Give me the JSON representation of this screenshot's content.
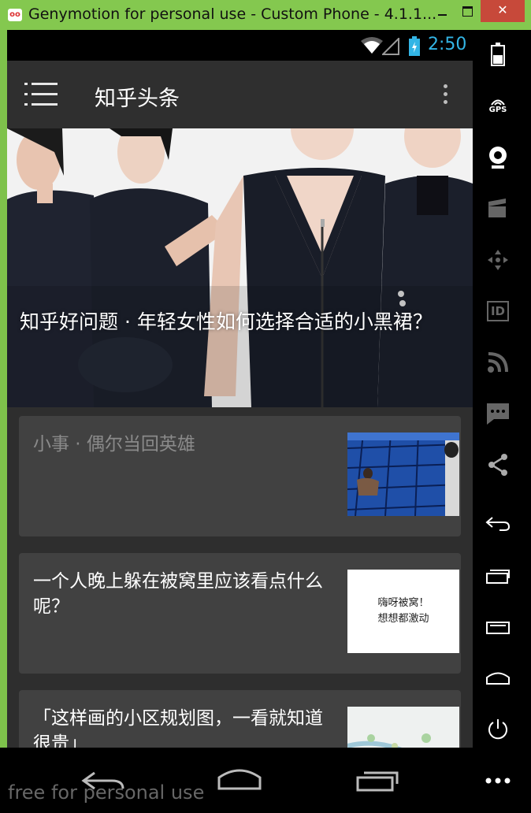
{
  "window": {
    "title": "Genymotion for personal use - Custom Phone - 4.1.1...",
    "close_glyph": "✕"
  },
  "status_bar": {
    "time": "2:50",
    "clock_color": "#33b5e5"
  },
  "action_bar": {
    "title": "知乎头条",
    "menu_icon": "hamburger-icon",
    "overflow_icon": "overflow-menu-icon"
  },
  "hero": {
    "caption": "知乎好问题 · 年轻女性如何选择合适的小黑裙？"
  },
  "stories": [
    {
      "title": "小事 · 偶尔当回英雄",
      "read": true,
      "thumbnail": "swimming-pool-photo"
    },
    {
      "title": "一个人晚上躲在被窝里应该看点什么呢？",
      "read": false,
      "thumbnail_text": [
        "嗨呀被窝！",
        "想想都激动"
      ]
    },
    {
      "title": "「这样画的小区规划图，一看就知道很贵」",
      "read": false,
      "thumbnail": "map-drawing-photo"
    }
  ],
  "watermark": "free for personal use",
  "sidebar": {
    "gps_label": "GPS",
    "id_label": "ID"
  }
}
